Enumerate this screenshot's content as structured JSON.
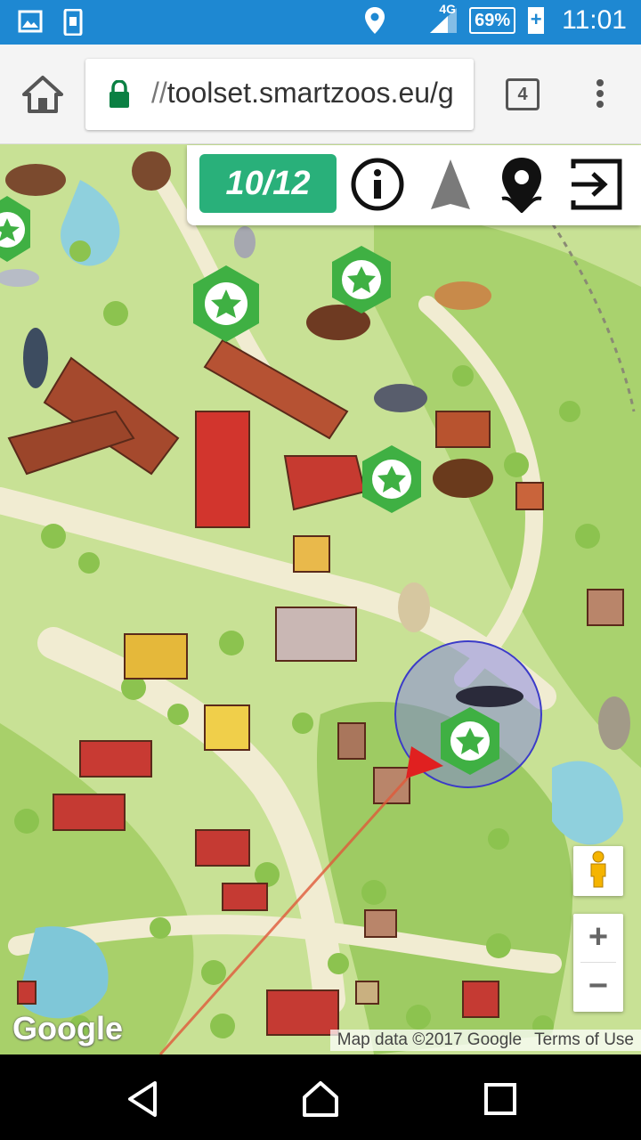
{
  "status_bar": {
    "network": "4G",
    "battery": "69%",
    "time": "11:01",
    "icons": [
      "image-icon",
      "phone-download-icon",
      "location-icon",
      "signal-icon",
      "battery-icon"
    ]
  },
  "browser": {
    "url_scheme": "//",
    "url_host": "toolset.smartzoos.eu/g",
    "tab_count": "4"
  },
  "game_toolbar": {
    "score": "10/12",
    "buttons": [
      "info-icon",
      "navigation-arrow-icon",
      "map-pin-icon",
      "exit-icon"
    ]
  },
  "map": {
    "logo": "Google",
    "attribution": "Map data ©2017 Google",
    "terms": "Terms of Use",
    "zoom_in": "+",
    "zoom_out": "−",
    "marker_count": 5,
    "accent": "#29b07a",
    "marker_color": "#3fb043"
  },
  "nav_bar": {
    "buttons": [
      "back-icon",
      "home-icon",
      "recents-icon"
    ]
  }
}
